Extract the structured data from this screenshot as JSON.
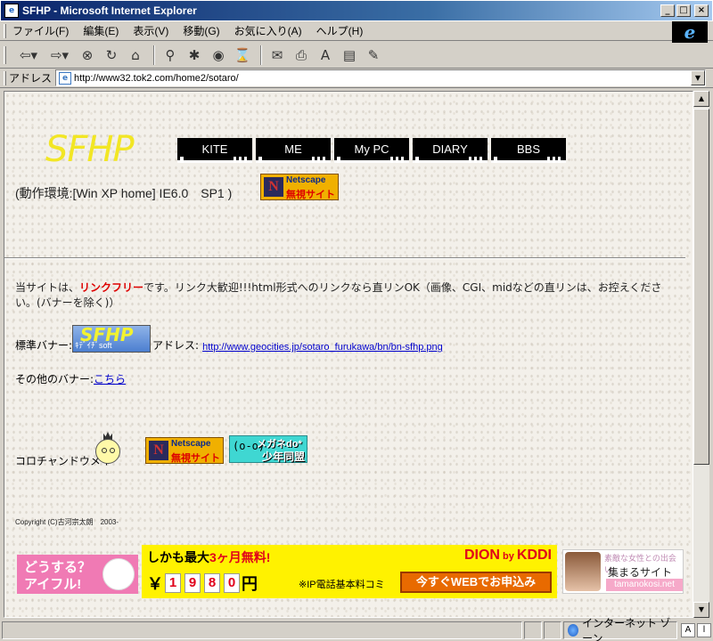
{
  "window": {
    "title": "SFHP - Microsoft Internet Explorer"
  },
  "menu": [
    "ファイル(F)",
    "編集(E)",
    "表示(V)",
    "移動(G)",
    "お気に入り(A)",
    "ヘルプ(H)"
  ],
  "address": {
    "label": "アドレス",
    "url": "http://www32.tok2.com/home2/sotaro/"
  },
  "page": {
    "logo": "SFHP",
    "nav": [
      "KITE",
      "ME",
      "My PC",
      "DIARY",
      "BBS"
    ],
    "env": "(動作環境:[Win XP home] IE6.0　SP1 )",
    "netscape_badge": {
      "top": "Netscape",
      "bottom": "無視サイト"
    },
    "policy_pre": "当サイトは、",
    "policy_hl": "リンクフリー",
    "policy_post": "です。リンク大歓迎!!!html形式へのリンクなら直リンOK（画像、CGI、midなどの直リンは、お控えください。(バナーを除く)）",
    "banner_label": "標準バナー:",
    "banner_big": "SFHP",
    "banner_small": "ｷﾃﾞｲﾁﾞsoft",
    "banner_addr_label": "アドレス:",
    "banner_url": "http://www.geocities.jp/sotaro_furukawa/bn/bn-sfhp.png",
    "other_label": "その他のバナー:",
    "other_link": "こちら",
    "mascot_label": "コロチャンドウメイ",
    "megane_glasses": "(o-o)",
    "megane_top": "メガネdo*",
    "megane_bottom": "少年同盟",
    "copyright": "Copyright (C)古河宗太朗　2003-"
  },
  "ads": {
    "aiful": {
      "line1": "どうする？",
      "line2": "アイフル!"
    },
    "dion": {
      "head_pre": "しかも最大",
      "head_red": "3ヶ月無料!",
      "brand": "DION",
      "brand_by": " by ",
      "brand_kddi": "KDDI",
      "yen": "￥",
      "digits": [
        "1",
        "9",
        "8",
        "0"
      ],
      "unit": "円",
      "note": "※IP電話基本料コミ",
      "cta": "今すぐWEBでお申込み"
    },
    "tama": {
      "line0": "素敵な女性との出会い",
      "line1": "集まるサイト",
      "line2": "tamanokosi.net"
    }
  },
  "status": {
    "zone": "インターネット ゾーン",
    "box1": "A",
    "box2": "l"
  }
}
